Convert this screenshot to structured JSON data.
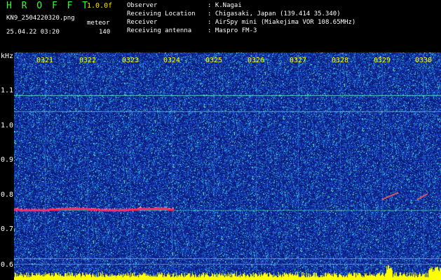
{
  "header": {
    "logo_text": "H R O F F T",
    "version": "1.0.0f",
    "filename": "KN9_2504220320.png",
    "datetime": "25.04.22 03:20",
    "meteor_label": "meteor",
    "meteor_count": "140",
    "info": [
      {
        "label": "Observer",
        "value": ": K.Nagai"
      },
      {
        "label": "Receiving Location",
        "value": ": Chigasaki, Japan (139.414 35.340)"
      },
      {
        "label": "Receiver",
        "value": ": AirSpy mini (Miakejima VOR 108.65MHz)"
      },
      {
        "label": "Receiving antenna",
        "value": ": Maspro FM-3"
      }
    ]
  },
  "axis": {
    "unit": "kHz",
    "ticks": [
      "1.1",
      "1.0",
      "0.9",
      "0.8",
      "0.7",
      "0.6"
    ]
  },
  "time_marks": [
    "0321",
    "0322",
    "0323",
    "0324",
    "0325",
    "0326",
    "0327",
    "0328",
    "0329",
    "0330"
  ],
  "colors": {
    "background": "#0a1a78",
    "noise_low": "#1a3cc8",
    "noise_high": "#33ffcc",
    "signal": "#ff2a60",
    "footer": "#ffff00"
  }
}
